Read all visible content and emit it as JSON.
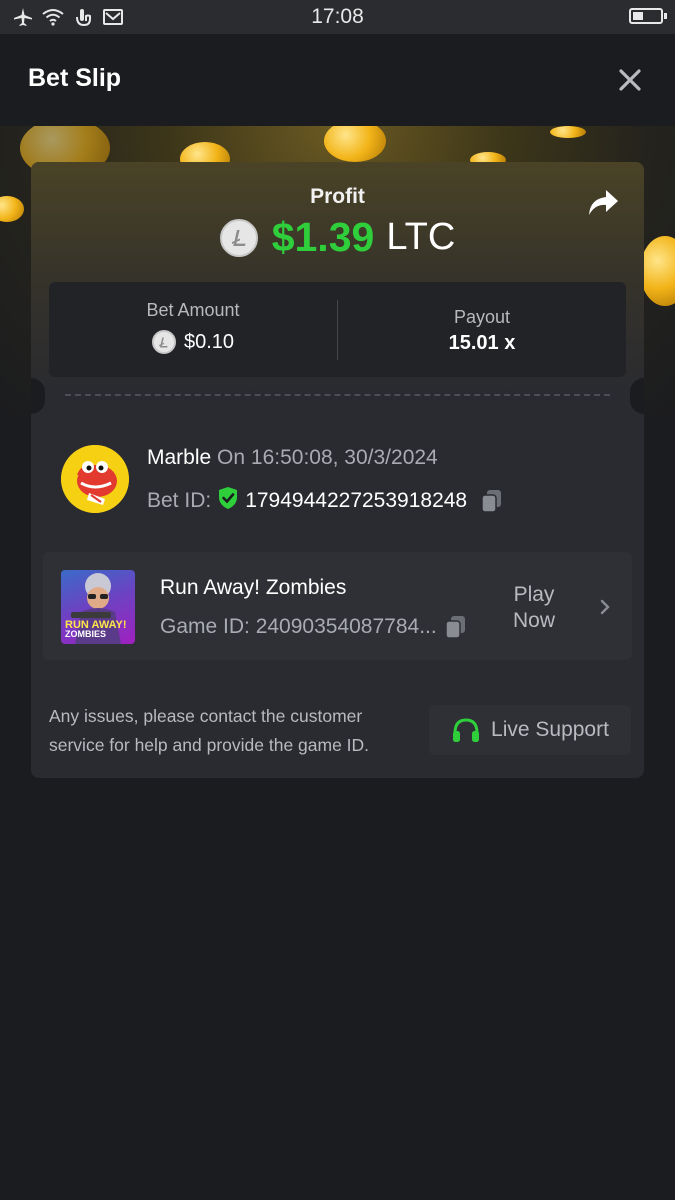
{
  "status_bar": {
    "time": "17:08"
  },
  "header": {
    "title": "Bet Slip"
  },
  "profit": {
    "label": "Profit",
    "amount": "$1.39",
    "currency": "LTC"
  },
  "bet_amount": {
    "label": "Bet Amount",
    "value": "$0.10"
  },
  "payout": {
    "label": "Payout",
    "value": "15.01 x"
  },
  "user": {
    "name": "Marble",
    "time_text": "On 16:50:08, 30/3/2024",
    "bet_id_label": "Bet ID:",
    "bet_id": "1794944227253918248"
  },
  "game": {
    "title": "Run Away! Zombies",
    "game_id_text": "Game ID: 24090354087784...",
    "thumb_title": "RUN AWAY!",
    "thumb_subtitle": "ZOMBIES",
    "play_label_1": "Play",
    "play_label_2": "Now"
  },
  "help": {
    "text": "Any issues, please contact the customer service for help and provide the game ID.",
    "support_label": "Live Support"
  },
  "colors": {
    "accent_green": "#2fcf3c",
    "background": "#1b1c1f",
    "card": "#2a2b30"
  }
}
